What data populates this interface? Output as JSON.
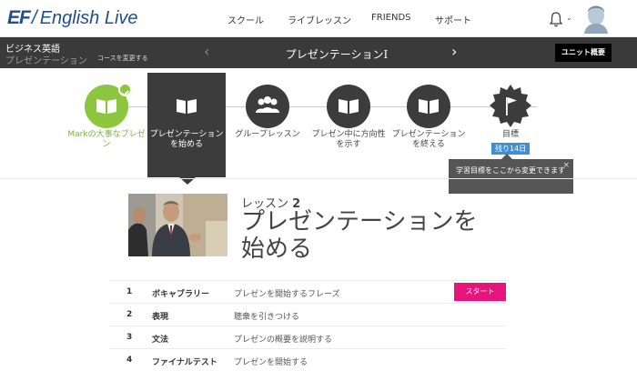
{
  "header": {
    "logo_mark": "EF",
    "logo_slash": "/",
    "logo_text": "English Live",
    "nav": [
      "スクール",
      "ライブレッスン",
      "FRIENDS",
      "サポート"
    ],
    "user_menu_chevron": "⌄",
    "icons": {
      "notifications": "bell-icon",
      "avatar": "user-avatar",
      "menu": "chevron-down-icon"
    }
  },
  "course_bar": {
    "category": "ビジネス英語",
    "course_name": "プレゼンテーション",
    "change_course": "コースを変更する",
    "prev_arrow": "‹",
    "next_arrow": "›",
    "unit_title": "プレゼンテーションI",
    "unit_overview": "ユニット概要"
  },
  "steps": [
    {
      "label": "Markの大事なプレゼン",
      "state": "done",
      "icon": "book-icon"
    },
    {
      "label": "プレゼンテーションを始める",
      "state": "active",
      "icon": "book-icon"
    },
    {
      "label": "グループレッスン",
      "state": "upcoming",
      "icon": "group-icon"
    },
    {
      "label": "プレゼン中に方向性を示す",
      "state": "upcoming",
      "icon": "book-icon"
    },
    {
      "label": "プレゼンテーションを終える",
      "state": "upcoming",
      "icon": "book-icon"
    },
    {
      "label": "目標",
      "state": "goal",
      "icon": "flag-icon"
    }
  ],
  "goal": {
    "days_left": "残り14日",
    "tooltip": "学習目標をここから変更できます",
    "tooltip_close": "×"
  },
  "lesson": {
    "kicker_label": "レッスン",
    "kicker_number": "2",
    "title": "プレゼンテーションを始める",
    "photo": "presenter-photo"
  },
  "activities": [
    {
      "num": "1",
      "name": "ボキャブラリー",
      "desc": "プレゼンを開始するフレーズ"
    },
    {
      "num": "2",
      "name": "表現",
      "desc": "聴衆を引きつける"
    },
    {
      "num": "3",
      "name": "文法",
      "desc": "プレゼンの概要を説明する"
    },
    {
      "num": "4",
      "name": "ファイナルテスト",
      "desc": "プレゼンを開始する"
    }
  ],
  "start_button": "スタート",
  "colors": {
    "accent_green": "#8cc63f",
    "dark_bar": "#3a3a3a",
    "start_pink": "#e7157b",
    "badge_blue": "#3f8fd2",
    "logo_blue": "#1d4f91"
  }
}
